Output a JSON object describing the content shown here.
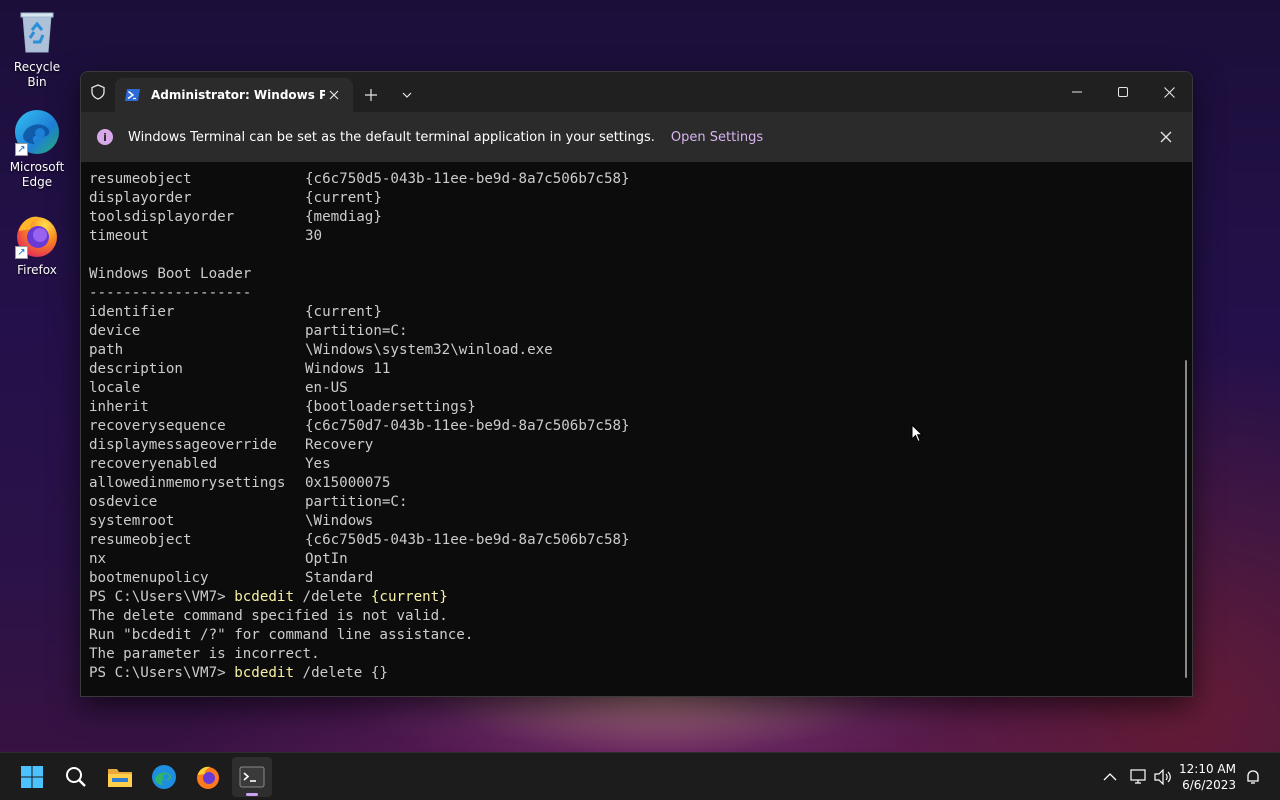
{
  "desktop": {
    "icons": [
      {
        "label": "Recycle Bin"
      },
      {
        "label": "Microsoft Edge"
      },
      {
        "label": "Firefox"
      }
    ]
  },
  "window": {
    "tab_title": "Administrator: Windows PowerShell",
    "infobar": {
      "message": "Windows Terminal can be set as the default terminal application in your settings.",
      "link": "Open Settings"
    }
  },
  "console": {
    "lines": [
      {
        "key": "resumeobject",
        "value": "{c6c750d5-043b-11ee-be9d-8a7c506b7c58}"
      },
      {
        "key": "displayorder",
        "value": "{current}"
      },
      {
        "key": "toolsdisplayorder",
        "value": "{memdiag}"
      },
      {
        "key": "timeout",
        "value": "30"
      },
      {
        "text": ""
      },
      {
        "text": "Windows Boot Loader"
      },
      {
        "text": "-------------------"
      },
      {
        "key": "identifier",
        "value": "{current}"
      },
      {
        "key": "device",
        "value": "partition=C:"
      },
      {
        "key": "path",
        "value": "\\Windows\\system32\\winload.exe"
      },
      {
        "key": "description",
        "value": "Windows 11"
      },
      {
        "key": "locale",
        "value": "en-US"
      },
      {
        "key": "inherit",
        "value": "{bootloadersettings}"
      },
      {
        "key": "recoverysequence",
        "value": "{c6c750d7-043b-11ee-be9d-8a7c506b7c58}"
      },
      {
        "key": "displaymessageoverride",
        "value": "Recovery"
      },
      {
        "key": "recoveryenabled",
        "value": "Yes"
      },
      {
        "key": "allowedinmemorysettings",
        "value": "0x15000075"
      },
      {
        "key": "osdevice",
        "value": "partition=C:"
      },
      {
        "key": "systemroot",
        "value": "\\Windows"
      },
      {
        "key": "resumeobject",
        "value": "{c6c750d5-043b-11ee-be9d-8a7c506b7c58}"
      },
      {
        "key": "nx",
        "value": "OptIn"
      },
      {
        "key": "bootmenupolicy",
        "value": "Standard"
      }
    ],
    "prompt1": {
      "prompt": "PS C:\\Users\\VM7> ",
      "cmd": "bcdedit",
      "args": " /delete ",
      "arg2": "{current}"
    },
    "output": [
      "The delete command specified is not valid.",
      "Run \"bcdedit /?\" for command line assistance.",
      "The parameter is incorrect."
    ],
    "prompt2": {
      "prompt": "PS C:\\Users\\VM7> ",
      "cmd": "bcdedit",
      "args": " /delete {}"
    }
  },
  "taskbar": {
    "time": "12:10 AM",
    "date": "6/6/2023"
  }
}
